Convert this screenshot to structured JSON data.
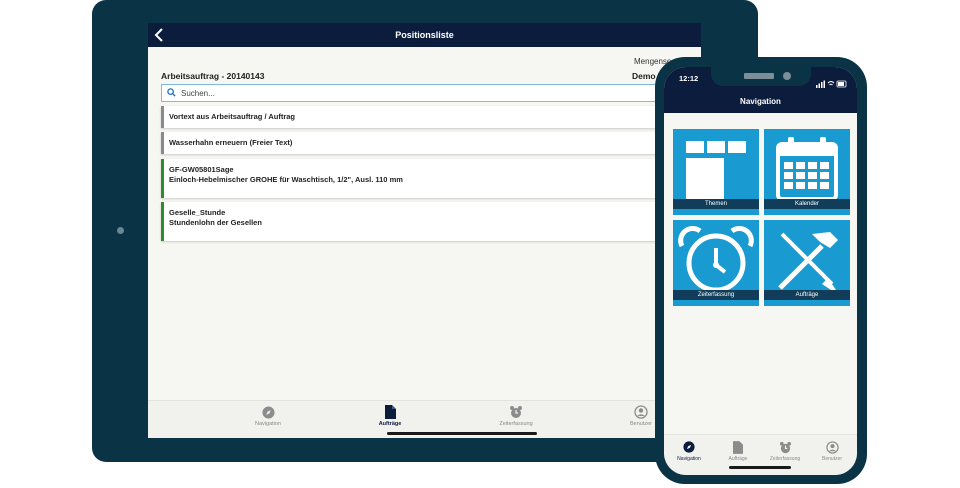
{
  "tablet": {
    "header": {
      "title": "Positionsliste"
    },
    "mengen_label": "Mengense",
    "order_label": "Arbeitsauftrag - 20140143",
    "demo_label": "Demo",
    "search": {
      "placeholder": "Suchen..."
    },
    "positions": [
      {
        "line1": "Vortext aus Arbeitsauftrag / Auftrag",
        "line2": "",
        "marker": "grey"
      },
      {
        "line1": "Wasserhahn erneuern (Freier Text)",
        "line2": "",
        "marker": "grey"
      },
      {
        "line1": "GF-GW05801Sage",
        "line2": "Einloch-Hebelmischer GROHE für Waschtisch, 1/2\", Ausl. 110 mm",
        "marker": "green"
      },
      {
        "line1": "Geselle_Stunde",
        "line2": "Stundenlohn der Gesellen",
        "marker": "green"
      }
    ],
    "bottom_nav": [
      {
        "label": "Navigation",
        "icon": "compass-icon",
        "active": false
      },
      {
        "label": "Aufträge",
        "icon": "document-icon",
        "active": true
      },
      {
        "label": "Zeiterfassung",
        "icon": "alarm-clock-icon",
        "active": false
      },
      {
        "label": "Benutzer",
        "icon": "user-icon",
        "active": false
      }
    ]
  },
  "phone": {
    "status": {
      "time": "12:12"
    },
    "header": {
      "title": "Navigation"
    },
    "tiles": [
      {
        "label": "Themen",
        "icon": "themes-icon"
      },
      {
        "label": "Kalender",
        "icon": "calendar-icon"
      },
      {
        "label": "Zeiterfassung",
        "icon": "alarm-clock-icon"
      },
      {
        "label": "Aufträge",
        "icon": "tools-icon"
      }
    ],
    "bottom_nav": [
      {
        "label": "Navigation",
        "icon": "compass-icon",
        "active": true
      },
      {
        "label": "Aufträge",
        "icon": "document-icon",
        "active": false
      },
      {
        "label": "Zeiterfassung",
        "icon": "alarm-clock-icon",
        "active": false
      },
      {
        "label": "Benutzer",
        "icon": "user-icon",
        "active": false
      }
    ]
  },
  "colors": {
    "device_frame": "#0b3346",
    "header_bg": "#0c1c3d",
    "tile_bg": "#199bd1",
    "marker_grey": "#8a8a8a",
    "marker_green": "#2e8b2e"
  }
}
